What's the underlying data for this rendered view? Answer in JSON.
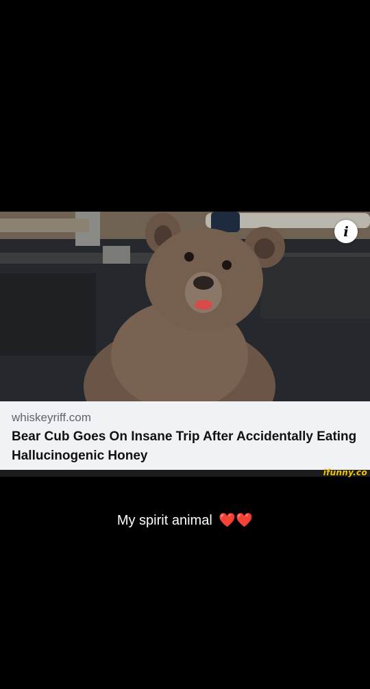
{
  "link_card": {
    "domain": "whiskeyriff.com",
    "headline": "Bear Cub Goes On Insane Trip After Accidentally Eating Hallucinogenic Honey",
    "info_icon_label": "i"
  },
  "watermark": "ifunny.co",
  "caption": {
    "text": "My spirit animal",
    "emoji": "❤️❤️"
  },
  "colors": {
    "background": "#000000",
    "card_background": "#f1f2f6",
    "watermark": "#f4c400"
  }
}
